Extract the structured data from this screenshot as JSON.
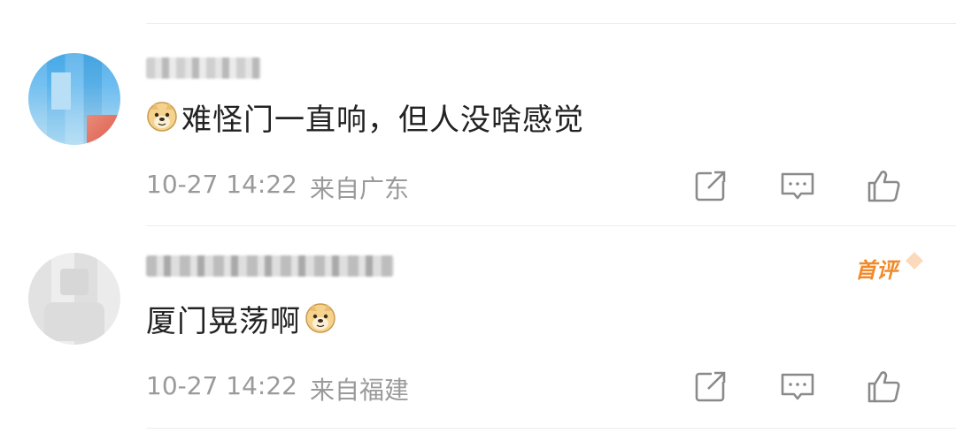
{
  "comments": [
    {
      "username": "",
      "text": "难怪门一直响，但人没啥感觉",
      "emoji_leading": "doge",
      "time": "10-27 14:22",
      "location": "来自广东",
      "badge": ""
    },
    {
      "username": "",
      "text": "厦门晃荡啊",
      "emoji_trailing": "doge",
      "time": "10-27 14:22",
      "location": "来自福建",
      "badge": "首评"
    }
  ],
  "icons": {
    "share": "share-icon",
    "comment": "comment-icon",
    "like": "like-icon",
    "emoji": "doge-emoji-icon"
  },
  "colors": {
    "text_primary": "#222222",
    "text_meta": "#9a9a9a",
    "badge": "#f08a2a",
    "icon": "#8a8a8a",
    "divider": "#ececec"
  }
}
